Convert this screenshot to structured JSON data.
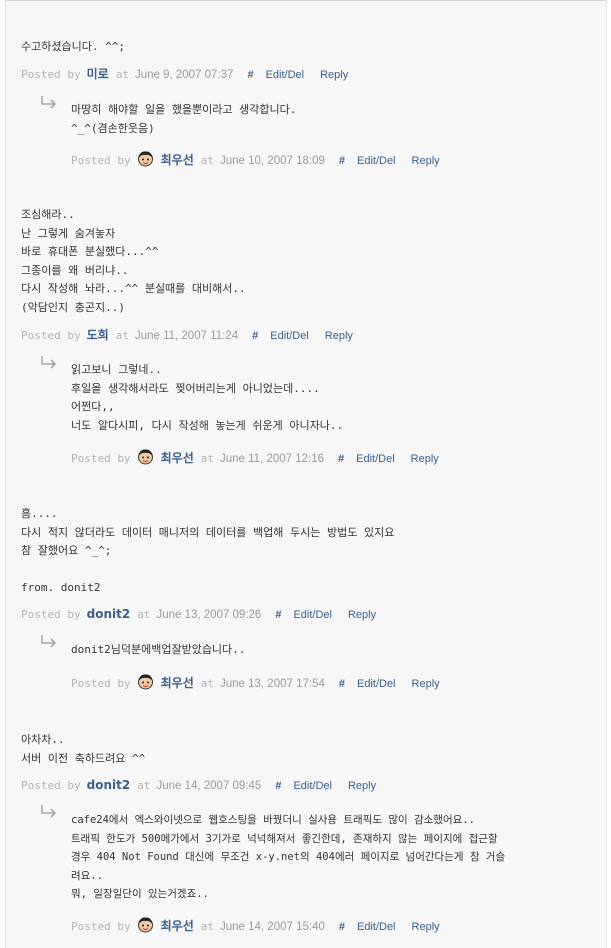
{
  "posted_by_label": "Posted by",
  "at_label": "at",
  "hash_label": "#",
  "edit_label": "Edit/Del",
  "reply_label": "Reply",
  "icons": {
    "reply_arrow": "reply-arrow-icon",
    "avatar": "avatar-icon"
  },
  "colors": {
    "link": "#3a5f8a",
    "meta": "#aaaaaa",
    "background": "#f7f7f7"
  },
  "comments": [
    {
      "lines": [
        "수고하셨습니다. ^^;"
      ],
      "author": "미로",
      "date": "June 9, 2007 07:37",
      "reply": {
        "lines": [
          "마땅히 해야할 일을 했을뿐이라고 생각합니다.",
          "^_^(겸손한웃음)"
        ],
        "author": "최우선",
        "date": "June 10, 2007 18:09"
      }
    },
    {
      "lines": [
        "조심해라..",
        "난 그렇게 숨겨놓자",
        "바로 휴대폰 분실했다...^^",
        "그종이를 왜 버리냐..",
        "다시 작성해 놔라...^^ 분실때를 대비해서..",
        "(악담인지 충곤지..)"
      ],
      "author": "도희",
      "date": "June 11, 2007 11:24",
      "reply": {
        "lines": [
          "읽고보니 그렇네..",
          "후일을 생각해서라도 찢어버리는게 아니었는데....",
          "어쩐다,,",
          "너도 알다시피, 다시 작성해 놓는게 쉬운게 아니자나.."
        ],
        "author": "최우선",
        "date": "June 11, 2007 12:16"
      }
    },
    {
      "lines": [
        "흠....",
        "다시 적지 않더라도 데이터 매니저의 데이터를 백업해 두시는 방법도 있지요",
        "참 잘했어요 ^_^;",
        "",
        "from. donit2"
      ],
      "author": "donit2",
      "date": "June 13, 2007 09:26",
      "reply": {
        "lines": [
          "donit2님덕분에백업잘받았습니다.."
        ],
        "author": "최우선",
        "date": "June 13, 2007 17:54"
      }
    },
    {
      "lines": [
        "아차차..",
        "서버 이전 축하드려요 ^^"
      ],
      "author": "donit2",
      "date": "June 14, 2007 09:45",
      "reply": {
        "lines": [
          "cafe24에서 엑스와이넷으로 웹호스팅을 바꿨더니 실사용 트래픽도 많이 감소했어요..",
          "트래픽 한도가 500메가에서 3기가로 넉넉해져서 좋긴한데, 존재하지 않는 페이지에 접근할",
          "경우 404 Not Found 대신에 무조건 x-y.net의 404에러 페이지로 넘어간다는게 참 거슬",
          "려요..",
          "뭐, 일장일단이 있는거겠죠.."
        ],
        "author": "최우선",
        "date": "June 14, 2007 15:40"
      }
    }
  ]
}
